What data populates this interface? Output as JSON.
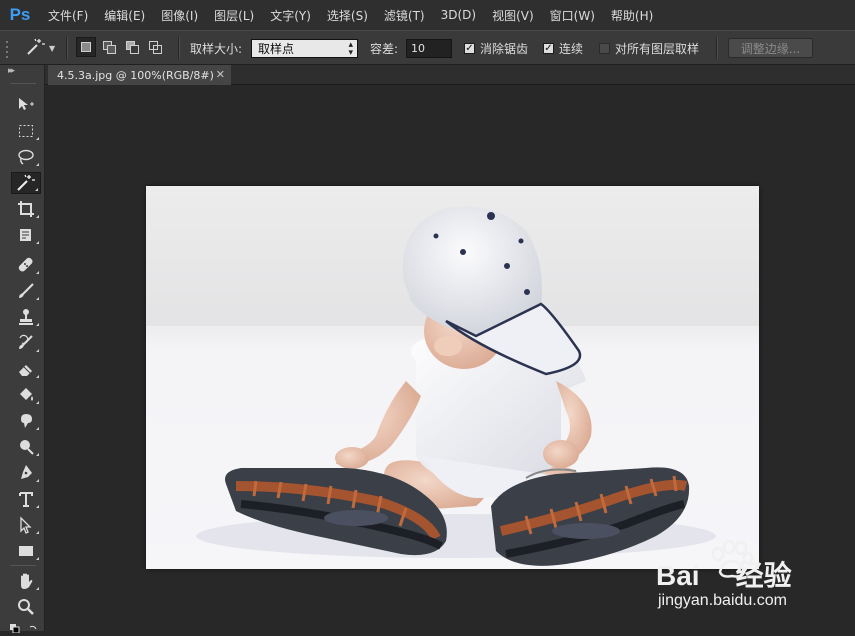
{
  "app": {
    "logo": "Ps"
  },
  "menu": [
    "文件(F)",
    "编辑(E)",
    "图像(I)",
    "图层(L)",
    "文字(Y)",
    "选择(S)",
    "滤镜(T)",
    "3D(D)",
    "视图(V)",
    "窗口(W)",
    "帮助(H)"
  ],
  "options": {
    "tool_icon": "magic-wand-icon",
    "selection_modes": [
      "new-selection",
      "add-to-selection",
      "subtract-from-selection",
      "intersect-with-selection"
    ],
    "sample_size_label": "取样大小:",
    "sample_size_value": "取样点",
    "tolerance_label": "容差:",
    "tolerance_value": "10",
    "antialias_label": "消除锯齿",
    "antialias_checked": true,
    "contiguous_label": "连续",
    "contiguous_checked": true,
    "sample_all_layers_label": "对所有图层取样",
    "sample_all_layers_checked": false,
    "refine_edge_label": "调整边缘..."
  },
  "document": {
    "tab_title": "4.5.3a.jpg @ 100%(RGB/8#)"
  },
  "tools": [
    "move-icon",
    "marquee-icon",
    "lasso-icon",
    "magic-wand-icon",
    "crop-icon",
    "eyedropper-icon",
    "healing-brush-icon",
    "brush-icon",
    "clone-stamp-icon",
    "history-brush-icon",
    "eraser-icon",
    "paint-bucket-icon",
    "blur-icon",
    "dodge-icon",
    "pen-icon",
    "type-icon",
    "path-selection-icon",
    "rectangle-icon",
    "hand-icon",
    "zoom-icon"
  ],
  "watermark": {
    "brand_left": "Bai",
    "brand_right": "经验",
    "url": "jingyan.baidu.com"
  },
  "colors": {
    "ps_blue": "#3d9df5",
    "ui_bg": "#282828",
    "panel_bg": "#3c3c3c"
  }
}
